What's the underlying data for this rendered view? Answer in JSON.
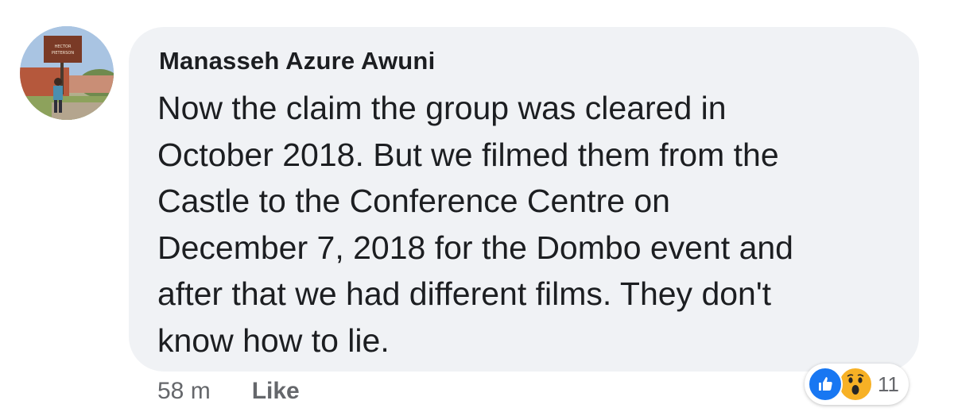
{
  "comment": {
    "author": "Manasseh Azure Awuni",
    "lines": [
      "Now the claim the group was cleared in",
      "October 2018. But we filmed them from the",
      "Castle to the Conference Centre on",
      "December 7, 2018 for the Dombo event and",
      "after that we had different films. They don't",
      "know how to lie."
    ],
    "time": "58 m",
    "like_label": "Like",
    "reaction_count": "11",
    "reactions": [
      "like-icon",
      "wow-icon"
    ]
  },
  "avatar": {
    "sign_text": "HECTOR PIETERSON"
  },
  "colors": {
    "bubble": "#f0f2f5",
    "text": "#1c1e21",
    "meta": "#65676b",
    "like_blue": "#1877f2",
    "wow_yellow": "#f7b125"
  }
}
